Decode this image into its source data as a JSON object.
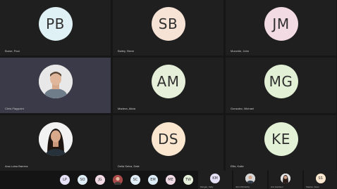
{
  "tiles": [
    {
      "initials": "PB",
      "name": "Burse, Paul",
      "color": "#dff1f5"
    },
    {
      "initials": "SB",
      "name": "Bailey, Steve",
      "color": "#f7e3d6"
    },
    {
      "initials": "JM",
      "name": "Moochie, John",
      "color": "#f3dbe3"
    },
    {
      "initials": "",
      "name": "Chris Flaypoint",
      "color": "#d9d9d9"
    },
    {
      "initials": "AM",
      "name": "Madera, Alicia",
      "color": "#e6efd9"
    },
    {
      "initials": "MG",
      "name": "Gonzalez, Michael",
      "color": "#e2f0d6"
    },
    {
      "initials": "",
      "name": "Ana-Luisa Barrera",
      "color": "#d9d9d9"
    },
    {
      "initials": "DS",
      "name": "Della Selva, Dale",
      "color": "#fbe7cf"
    },
    {
      "initials": "KE",
      "name": "Ellis, Katie",
      "color": "#e3f1d6"
    }
  ],
  "bottom_chips": [
    {
      "initials": "LP",
      "color": "#e6e1f6"
    },
    {
      "initials": "SO",
      "color": "#e0eef7"
    },
    {
      "initials": "JG",
      "color": "#f3dbe6"
    },
    {
      "initials": "",
      "color": "#b24d4d"
    },
    {
      "initials": "SC",
      "color": "#e1eef8"
    },
    {
      "initials": "EM",
      "color": "#dcedf7"
    },
    {
      "initials": "ME",
      "color": "#f3dbe6"
    },
    {
      "initials": "TW",
      "color": "#e6efd9"
    }
  ],
  "bottom_tiles": [
    {
      "initials": "KM",
      "name": "Morgan, Kelly",
      "color": "#e6e1f6"
    },
    {
      "initials": "",
      "name": "John McCarthy",
      "color": "#cfcfcf"
    },
    {
      "initials": "",
      "name": "Ann Harrison",
      "color": "#d9d9d9"
    },
    {
      "initials": "SS",
      "name": "Stanley, Sean",
      "color": "#fbe7cf"
    }
  ]
}
